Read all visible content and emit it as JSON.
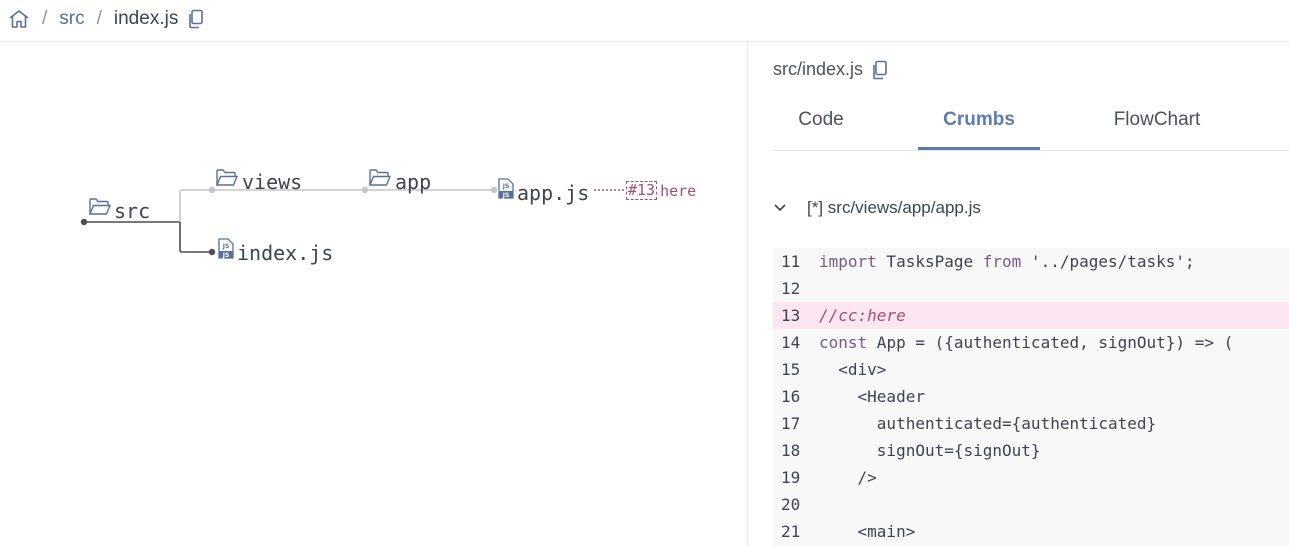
{
  "breadcrumb": {
    "home_icon": "home-icon",
    "items": [
      "src",
      "index.js"
    ],
    "separator": "/",
    "copy_icon": "copy-icon"
  },
  "graph": {
    "root": "src",
    "nodes": {
      "views": "views",
      "app": "app",
      "appjs": "app.js",
      "indexjs": "index.js"
    },
    "tag_number": "#13",
    "tag_text": "here"
  },
  "panel": {
    "path": "src/index.js",
    "tabs": [
      "Code",
      "Crumbs",
      "FlowChart"
    ],
    "active_tab": "Crumbs",
    "file_header": "[*] src/views/app/app.js",
    "code": [
      {
        "n": "11",
        "t": "import TasksPage from '../pages/tasks';"
      },
      {
        "n": "12",
        "t": ""
      },
      {
        "n": "13",
        "t": "//cc:here",
        "highlight": true
      },
      {
        "n": "14",
        "t": "const App = ({authenticated, signOut}) => ("
      },
      {
        "n": "15",
        "t": "  <div>"
      },
      {
        "n": "16",
        "t": "    <Header"
      },
      {
        "n": "17",
        "t": "      authenticated={authenticated}"
      },
      {
        "n": "18",
        "t": "      signOut={signOut}"
      },
      {
        "n": "19",
        "t": "    />"
      },
      {
        "n": "20",
        "t": ""
      },
      {
        "n": "21",
        "t": "    <main>"
      }
    ]
  },
  "colors": {
    "accent": "#5d7bb0",
    "tag": "#a44d75",
    "highlight": "#fbe6f2",
    "edge_light": "#c4c6cc",
    "edge_dark": "#4a4d55"
  }
}
